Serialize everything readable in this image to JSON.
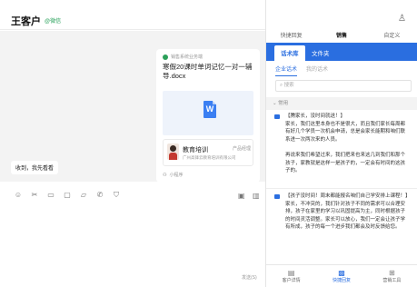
{
  "window": {
    "min": "—",
    "restore": "☐",
    "close": "✕"
  },
  "chat": {
    "contact_name": "王客户",
    "contact_tag": "@微信",
    "card": {
      "source": "销售系统业务端",
      "title": "寒假20课时单词记忆一对一辅导.docx",
      "doc_letter": "W",
      "mini": {
        "name": "教育培训",
        "company": "广州高锋云教育培训有限公司",
        "product": "产品经理"
      },
      "footer": "小程序"
    },
    "bubble": "收到，我先看看",
    "send_hint": "发送(S)"
  },
  "assist": {
    "top_tabs": [
      "快捷回复",
      "销售",
      "自定义"
    ],
    "lib_tabs": [
      "话术库",
      "文件夹"
    ],
    "sub_tabs": [
      "企业话术",
      "我的话术"
    ],
    "search_placeholder": "搜索",
    "section_label": "常用",
    "items": [
      "【腾家长，没时间就送！】\n家长，我们这里本身也不是很大，而且我们家长每周都有好几个学员一次机会申请，总是会家长能期和咱们联系进一次两次来的人员。\n\n再说来我们希望过来，我们把来也来这几到我们和那个孩子，家教就是这样一是孩子的，一定会有时间的这孩子的。",
      "【孩子没时间！周末都能报名咱们自己学安排上课程！】家长，不冲突的，我们针对孩子不同的需求可以合理安排，孩子在家里的学习以巩固提高为主，同时根据孩子的时间灵活调整。家长可以放心，我们一定会让孩子学有所成，孩子的每一个进步我们都会及时反馈给您。"
    ],
    "bottom_nav": [
      "客户详情",
      "快捷回复",
      "营销工具"
    ]
  },
  "colors": {
    "accent": "#2a6ee0",
    "wechat_green": "#27a15a",
    "chat_bg": "#f3f3f3"
  }
}
